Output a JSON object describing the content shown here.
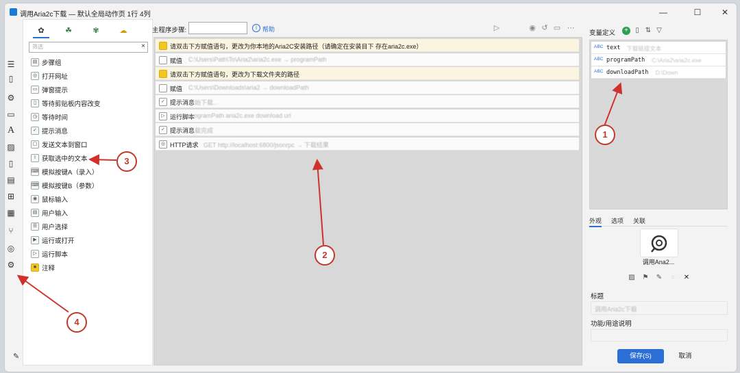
{
  "window": {
    "title": "调用Aria2c下载 — 默认全局动作页 1行 4列",
    "minimize": "—",
    "maximize": "☐",
    "close": "✕"
  },
  "left_panel": {
    "search_placeholder": "筛选",
    "search_clear": "×",
    "tabs": [
      "✿",
      "☘",
      "✾",
      "☁"
    ],
    "items": [
      {
        "label": "步骤组",
        "icon": "step-group-icon",
        "glyph": "▤"
      },
      {
        "label": "打开网址",
        "icon": "globe-icon",
        "glyph": "◎"
      },
      {
        "label": "弹窗提示",
        "icon": "popup-icon",
        "glyph": "▭"
      },
      {
        "label": "等待剪贴板内容改变",
        "icon": "clipboard-wait-icon",
        "glyph": "▯"
      },
      {
        "label": "等待时间",
        "icon": "clock-icon",
        "glyph": "◷"
      },
      {
        "label": "提示消息",
        "icon": "message-icon",
        "glyph": "✓"
      },
      {
        "label": "发送文本到窗口",
        "icon": "send-text-icon",
        "glyph": "▢"
      },
      {
        "label": "获取选中的文本",
        "icon": "text-cursor-icon",
        "glyph": "I"
      },
      {
        "label": "模拟按键A（录入）",
        "icon": "keyboard-icon",
        "glyph": "⌨"
      },
      {
        "label": "模拟按键B（参数）",
        "icon": "keyboard-icon",
        "glyph": "⌨"
      },
      {
        "label": "鼠标输入",
        "icon": "mouse-icon",
        "glyph": "◉"
      },
      {
        "label": "用户输入",
        "icon": "user-input-icon",
        "glyph": "▤"
      },
      {
        "label": "用户选择",
        "icon": "user-select-icon",
        "glyph": "☰"
      },
      {
        "label": "运行或打开",
        "icon": "run-icon",
        "glyph": "▶"
      },
      {
        "label": "运行脚本",
        "icon": "script-icon",
        "glyph": "▷"
      },
      {
        "label": "注释",
        "icon": "note-icon",
        "glyph": "■"
      }
    ]
  },
  "main": {
    "steps_label": "主程序步骤:",
    "help_link": "帮助",
    "steps": [
      {
        "type": "note",
        "name": "请双击下方赋值语句，更改为你本地的Aria2C安装路径（请确定在安装目下  存在aria2c.exe）",
        "desc": ""
      },
      {
        "type": "assign",
        "name": "赋值",
        "desc": "C:\\Users\\Path\\To\\Aria2\\aria2c.exe → programPath"
      },
      {
        "type": "note",
        "name": "请双击下方赋值语句，更改为下载文件夹的路径",
        "desc": ""
      },
      {
        "type": "assign",
        "name": "赋值",
        "desc": "C:\\Users\\Downloads\\aria2 → downloadPath"
      },
      {
        "type": "message",
        "name": "提示消息",
        "desc": "开始下载..."
      },
      {
        "type": "script",
        "name": "运行脚本",
        "desc": "programPath aria2c.exe download url"
      },
      {
        "type": "message",
        "name": "提示消息",
        "desc": "下载完成"
      },
      {
        "type": "http",
        "name": "HTTP请求",
        "desc": "GET http://localhost:6800/jsonrpc → 下载结果"
      }
    ]
  },
  "right_panel": {
    "vars_title": "变量定义",
    "vars": [
      {
        "badge": "ABC",
        "name": "text",
        "value": "下载链接文本"
      },
      {
        "badge": "ABC",
        "name": "programPath",
        "value": "C:\\Aria2\\aria2c.exe"
      },
      {
        "badge": "ABC",
        "name": "downloadPath",
        "value": "D:\\Down"
      }
    ],
    "tabs": [
      "外观",
      "选项",
      "关联"
    ],
    "app_label": "调用Ana2...",
    "title_label": "标题",
    "title_value": "调用Aria2c下载",
    "desc_label": "功能/用途说明",
    "desc_value": "",
    "save_button": "保存(S)",
    "cancel_button": "取消"
  },
  "annotations": [
    "1",
    "2",
    "3",
    "4"
  ],
  "colors": {
    "accent": "#2b6fd6",
    "note": "#f3c623",
    "annotation": "#c0392b"
  }
}
